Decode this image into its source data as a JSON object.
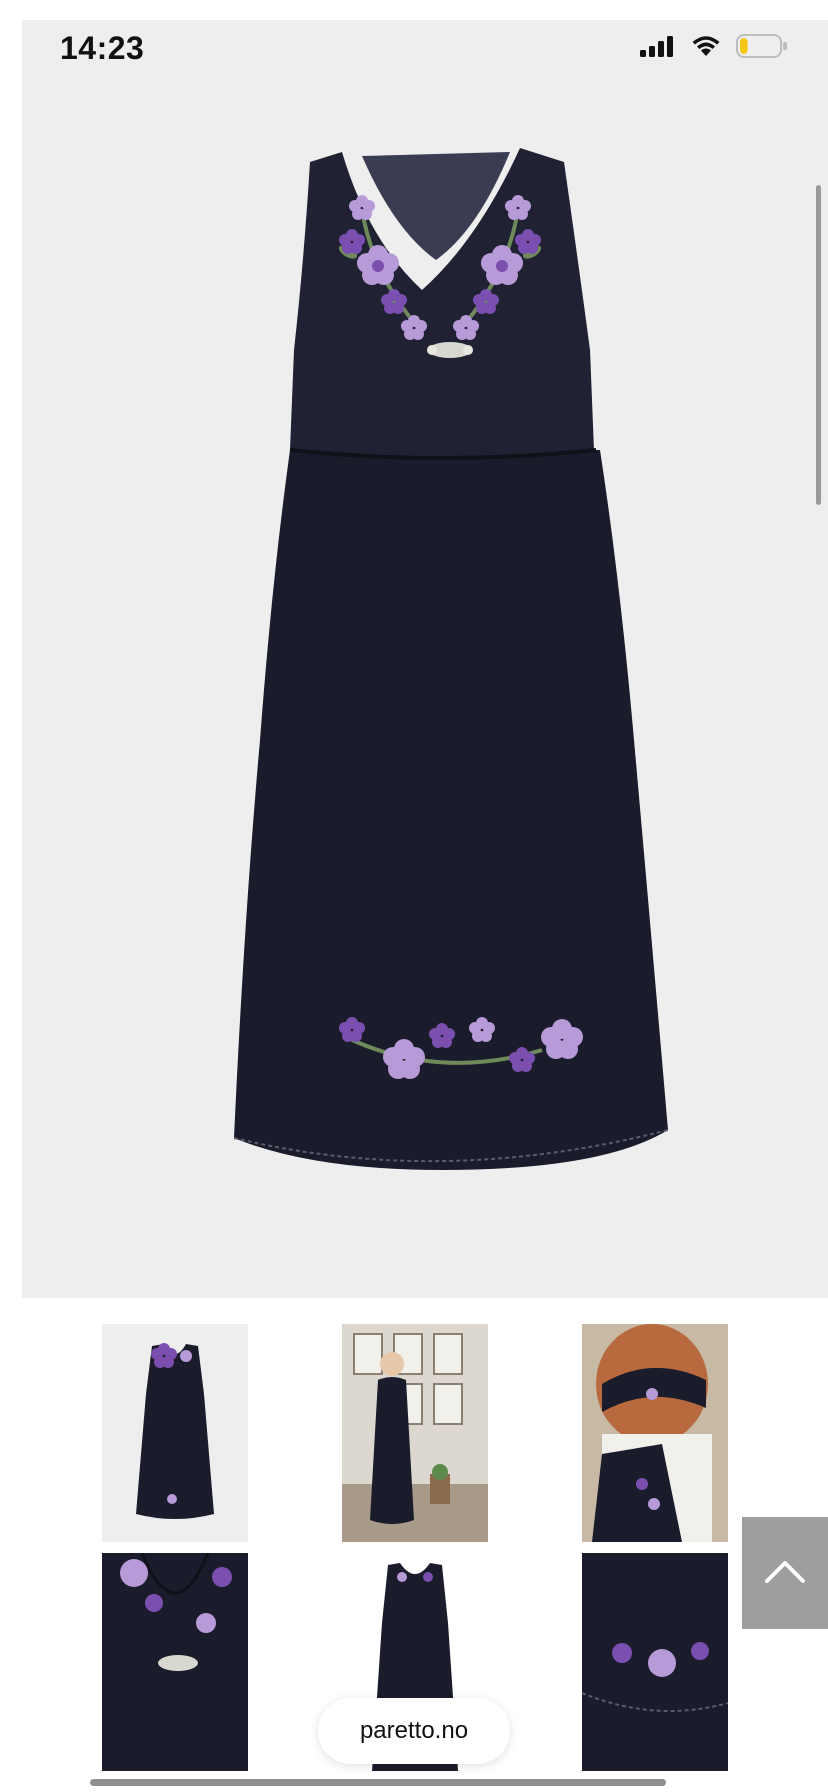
{
  "status_bar": {
    "time": "14:23",
    "icons": [
      "cellular-signal-icon",
      "wifi-icon",
      "battery-icon"
    ],
    "battery_level": 0.2,
    "battery_color": "#f5c518"
  },
  "product": {
    "hero_image": "navy-embroidered-bunad-dress",
    "thumbnails": [
      "dress-front-thumbnail",
      "girl-wearing-dress-outdoors-thumbnail",
      "girl-with-headband-closeup-thumbnail",
      "bodice-embroidery-closeup-thumbnail",
      "dress-front-small-thumbnail",
      "hem-embroidery-closeup-thumbnail"
    ]
  },
  "scroll_top_button": {
    "icon": "chevron-up-icon"
  },
  "browser": {
    "url": "paretto.no"
  },
  "colors": {
    "dress": "#1b1c2b",
    "embroidery_purple": "#7a4fb0",
    "embroidery_lilac": "#b79ad8",
    "leaf_green": "#6f8a5a",
    "background": "#eeeeee"
  }
}
